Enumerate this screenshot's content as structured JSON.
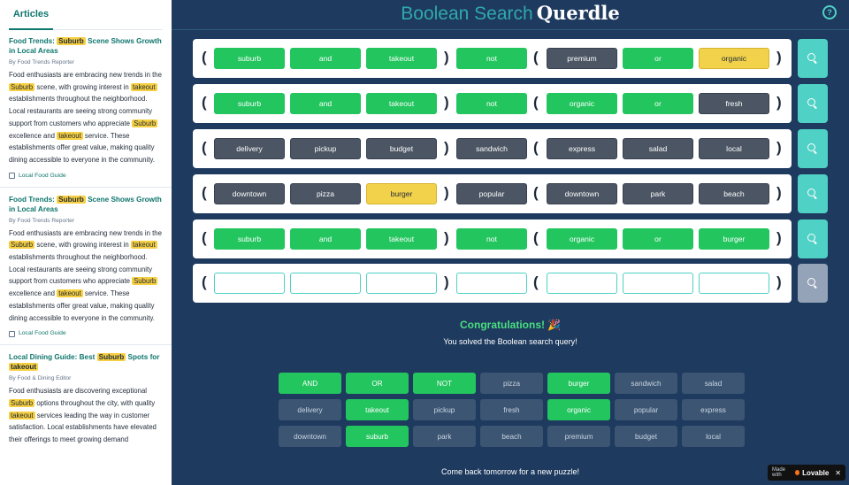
{
  "sidebar": {
    "tab": "Articles",
    "articles": [
      {
        "title_pre": "Food Trends: ",
        "title_hl": "Suburb",
        "title_post": " Scene Shows Growth in Local Areas",
        "author": "By Food Trends Reporter",
        "p1": "Food enthusiasts are embracing new trends in the ",
        "hl1": "Suburb",
        "p2": " scene, with growing interest in ",
        "hl2": "takeout",
        "p3": " establishments throughout the neighborhood. Local restaurants are seeing strong community support from customers who appreciate ",
        "hl3": "Suburb",
        "p4": " excellence and ",
        "hl4": "takeout",
        "p5": " service. These establishments offer great value, making quality dining accessible to everyone in the community.",
        "source": "Local Food Guide"
      },
      {
        "title_pre": "Food Trends: ",
        "title_hl": "Suburb",
        "title_post": " Scene Shows Growth in Local Areas",
        "author": "By Food Trends Reporter",
        "p1": "Food enthusiasts are embracing new trends in the ",
        "hl1": "Suburb",
        "p2": " scene, with growing interest in ",
        "hl2": "takeout",
        "p3": " establishments throughout the neighborhood. Local restaurants are seeing strong community support from customers who appreciate ",
        "hl3": "Suburb",
        "p4": " excellence and ",
        "hl4": "takeout",
        "p5": " service. These establishments offer great value, making quality dining accessible to everyone in the community.",
        "source": "Local Food Guide"
      },
      {
        "title_pre": "Local Dining Guide: Best ",
        "title_hl": "Suburb",
        "title_post": " Spots for ",
        "title_hl2": "takeout",
        "author": "By Food & Dining Editor",
        "p1": "Food enthusiasts are discovering exceptional ",
        "hl1": "Suburb",
        "p2": " options throughout the city, with quality ",
        "hl2": "takeout",
        "p3": " services leading the way in customer satisfaction. Local establishments have elevated their offerings to meet growing demand"
      }
    ]
  },
  "header": {
    "title_part1": "Boolean Search",
    "title_part2": "Querdle",
    "help_glyph": "?"
  },
  "rows": [
    {
      "tiles": [
        {
          "word": "suburb",
          "state": "green"
        },
        {
          "word": "and",
          "state": "green"
        },
        {
          "word": "takeout",
          "state": "green"
        },
        {
          "word": "not",
          "state": "green"
        },
        {
          "word": "premium",
          "state": "gray"
        },
        {
          "word": "or",
          "state": "green"
        },
        {
          "word": "organic",
          "state": "yellow"
        }
      ]
    },
    {
      "tiles": [
        {
          "word": "suburb",
          "state": "green"
        },
        {
          "word": "and",
          "state": "green"
        },
        {
          "word": "takeout",
          "state": "green"
        },
        {
          "word": "not",
          "state": "green"
        },
        {
          "word": "organic",
          "state": "green"
        },
        {
          "word": "or",
          "state": "green"
        },
        {
          "word": "fresh",
          "state": "gray"
        }
      ]
    },
    {
      "tiles": [
        {
          "word": "delivery",
          "state": "gray"
        },
        {
          "word": "pickup",
          "state": "gray"
        },
        {
          "word": "budget",
          "state": "gray"
        },
        {
          "word": "sandwich",
          "state": "gray"
        },
        {
          "word": "express",
          "state": "gray"
        },
        {
          "word": "salad",
          "state": "gray"
        },
        {
          "word": "local",
          "state": "gray"
        }
      ]
    },
    {
      "tiles": [
        {
          "word": "downtown",
          "state": "gray"
        },
        {
          "word": "pizza",
          "state": "gray"
        },
        {
          "word": "burger",
          "state": "yellow"
        },
        {
          "word": "popular",
          "state": "gray"
        },
        {
          "word": "downtown",
          "state": "gray"
        },
        {
          "word": "park",
          "state": "gray"
        },
        {
          "word": "beach",
          "state": "gray"
        }
      ]
    },
    {
      "tiles": [
        {
          "word": "suburb",
          "state": "green"
        },
        {
          "word": "and",
          "state": "green"
        },
        {
          "word": "takeout",
          "state": "green"
        },
        {
          "word": "not",
          "state": "green"
        },
        {
          "word": "organic",
          "state": "green"
        },
        {
          "word": "or",
          "state": "green"
        },
        {
          "word": "burger",
          "state": "green"
        }
      ]
    },
    {
      "tiles": [
        {
          "word": "",
          "state": "empty"
        },
        {
          "word": "",
          "state": "empty"
        },
        {
          "word": "",
          "state": "empty"
        },
        {
          "word": "",
          "state": "empty"
        },
        {
          "word": "",
          "state": "empty"
        },
        {
          "word": "",
          "state": "empty"
        },
        {
          "word": "",
          "state": "empty"
        }
      ]
    }
  ],
  "paren_open": "(",
  "paren_close": ")",
  "result": {
    "congrats": "Congratulations!",
    "party": "🎉",
    "solved": "You solved the Boolean search query!"
  },
  "keyboard": [
    [
      {
        "word": "AND",
        "on": true
      },
      {
        "word": "OR",
        "on": true
      },
      {
        "word": "NOT",
        "on": true
      },
      {
        "word": "pizza",
        "on": false
      },
      {
        "word": "burger",
        "on": true
      },
      {
        "word": "sandwich",
        "on": false
      },
      {
        "word": "salad",
        "on": false
      }
    ],
    [
      {
        "word": "delivery",
        "on": false
      },
      {
        "word": "takeout",
        "on": true
      },
      {
        "word": "pickup",
        "on": false
      },
      {
        "word": "fresh",
        "on": false
      },
      {
        "word": "organic",
        "on": true
      },
      {
        "word": "popular",
        "on": false
      },
      {
        "word": "express",
        "on": false
      }
    ],
    [
      {
        "word": "downtown",
        "on": false
      },
      {
        "word": "suburb",
        "on": true
      },
      {
        "word": "park",
        "on": false
      },
      {
        "word": "beach",
        "on": false
      },
      {
        "word": "premium",
        "on": false
      },
      {
        "word": "budget",
        "on": false
      },
      {
        "word": "local",
        "on": false
      }
    ]
  ],
  "footer": {
    "comeback": "Come back tomorrow for a new puzzle!"
  },
  "badge": {
    "made_with": "Made with",
    "brand": "Lovable",
    "close": "✕"
  },
  "colors": {
    "background": "#1e3a5f",
    "correct": "#22c55e",
    "present": "#f2d24b",
    "absent": "#4b5563",
    "accent": "#4fd1c5"
  }
}
